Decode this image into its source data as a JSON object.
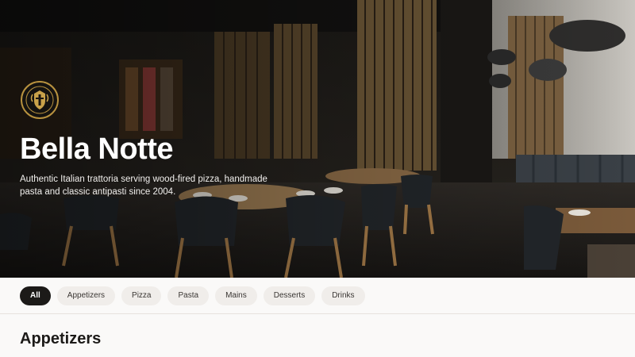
{
  "hero": {
    "title": "Bella Notte",
    "description": "Authentic Italian trattoria serving wood-fired pizza, handmade pasta and classic antipasti since 2004.",
    "logo_icon": "restaurant-crest-icon"
  },
  "filters": {
    "items": [
      {
        "label": "All",
        "active": true
      },
      {
        "label": "Appetizers",
        "active": false
      },
      {
        "label": "Pizza",
        "active": false
      },
      {
        "label": "Pasta",
        "active": false
      },
      {
        "label": "Mains",
        "active": false
      },
      {
        "label": "Desserts",
        "active": false
      },
      {
        "label": "Drinks",
        "active": false
      }
    ]
  },
  "section": {
    "title": "Appetizers"
  },
  "colors": {
    "accent_dark": "#1c1a18",
    "chip_bg": "#f0edea",
    "crest_gold": "#b8923f"
  }
}
